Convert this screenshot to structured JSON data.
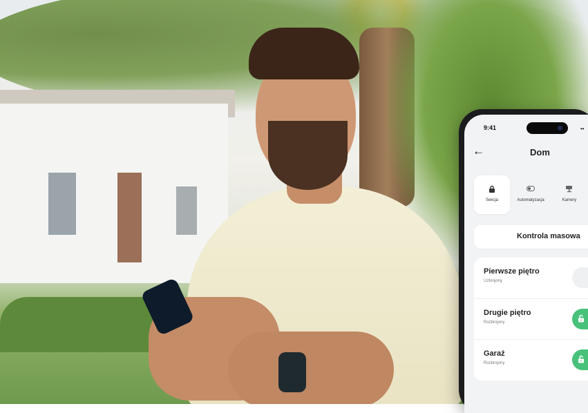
{
  "status": {
    "time": "9:41"
  },
  "header": {
    "back_icon": "arrow-left-icon",
    "title": "Dom"
  },
  "tabs": [
    {
      "label": "Sekcja",
      "icon": "lock-icon",
      "active": true
    },
    {
      "label": "Automatyzacja",
      "icon": "toggle-icon",
      "active": false
    },
    {
      "label": "Kamery",
      "icon": "camera-icon",
      "active": false
    }
  ],
  "mass_control": {
    "label": "Kontrola masowa"
  },
  "sections": [
    {
      "name": "Pierwsze piętro",
      "state": "Uzbrojony",
      "toggle": "off"
    },
    {
      "name": "Drugie piętro",
      "state": "Rozbrojony",
      "toggle": "on"
    },
    {
      "name": "Garaż",
      "state": "Rozbrojony",
      "toggle": "on"
    }
  ],
  "colors": {
    "accent_green": "#48c27a",
    "screen_bg": "#f2f3f5",
    "card_bg": "#ffffff"
  }
}
